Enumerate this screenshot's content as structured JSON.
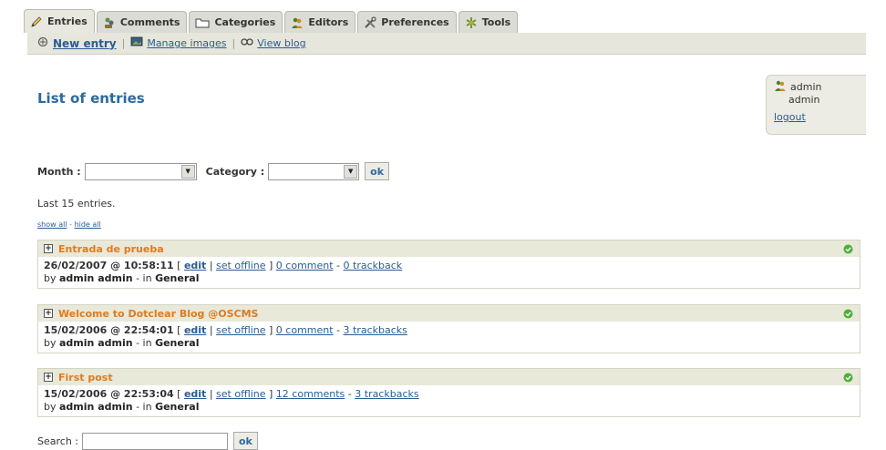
{
  "tabs": [
    {
      "label": "Entries",
      "icon": "pencil-icon",
      "active": true
    },
    {
      "label": "Comments",
      "icon": "comments-icon",
      "active": false
    },
    {
      "label": "Categories",
      "icon": "folder-icon",
      "active": false
    },
    {
      "label": "Editors",
      "icon": "users-icon",
      "active": false
    },
    {
      "label": "Preferences",
      "icon": "tools-icon",
      "active": false
    },
    {
      "label": "Tools",
      "icon": "plugin-icon",
      "active": false
    }
  ],
  "subnav": {
    "new_entry": "New entry",
    "manage_images": "Manage images",
    "view_blog": "View blog",
    "separator": "|"
  },
  "page_title": "List of entries",
  "user": {
    "name": "admin",
    "role": "admin",
    "logout": "logout"
  },
  "filter": {
    "month_label": "Month :",
    "month_value": "",
    "category_label": "Category :",
    "category_value": "",
    "ok_label": "ok"
  },
  "last_info": "Last 15 entries.",
  "show_all": "show all",
  "hide_all": "hide all",
  "showhide_sep": "-",
  "entries": [
    {
      "title": "Entrada de prueba",
      "date": "26/02/2007 @ 10:58:11",
      "edit": "edit",
      "set_offline": "set offline",
      "comments": "0 comment",
      "trackbacks": "0 trackback",
      "by": "by",
      "author": "admin admin",
      "in": "- in",
      "category": "General"
    },
    {
      "title": "Welcome to Dotclear Blog @OSCMS",
      "date": "15/02/2006 @ 22:54:01",
      "edit": "edit",
      "set_offline": "set offline",
      "comments": "0 comment",
      "trackbacks": "3 trackbacks",
      "by": "by",
      "author": "admin admin",
      "in": "- in",
      "category": "General"
    },
    {
      "title": "First post",
      "date": "15/02/2006 @ 22:53:04",
      "edit": "edit",
      "set_offline": "set offline",
      "comments": "12 comments",
      "trackbacks": "3 trackbacks",
      "by": "by",
      "author": "admin admin",
      "in": "- in",
      "category": "General"
    }
  ],
  "search": {
    "label": "Search :",
    "value": "",
    "ok_label": "ok"
  },
  "colors": {
    "accent_blue": "#2b6aa0",
    "entry_title": "#e07a1c",
    "status_green": "#4caf3a"
  }
}
